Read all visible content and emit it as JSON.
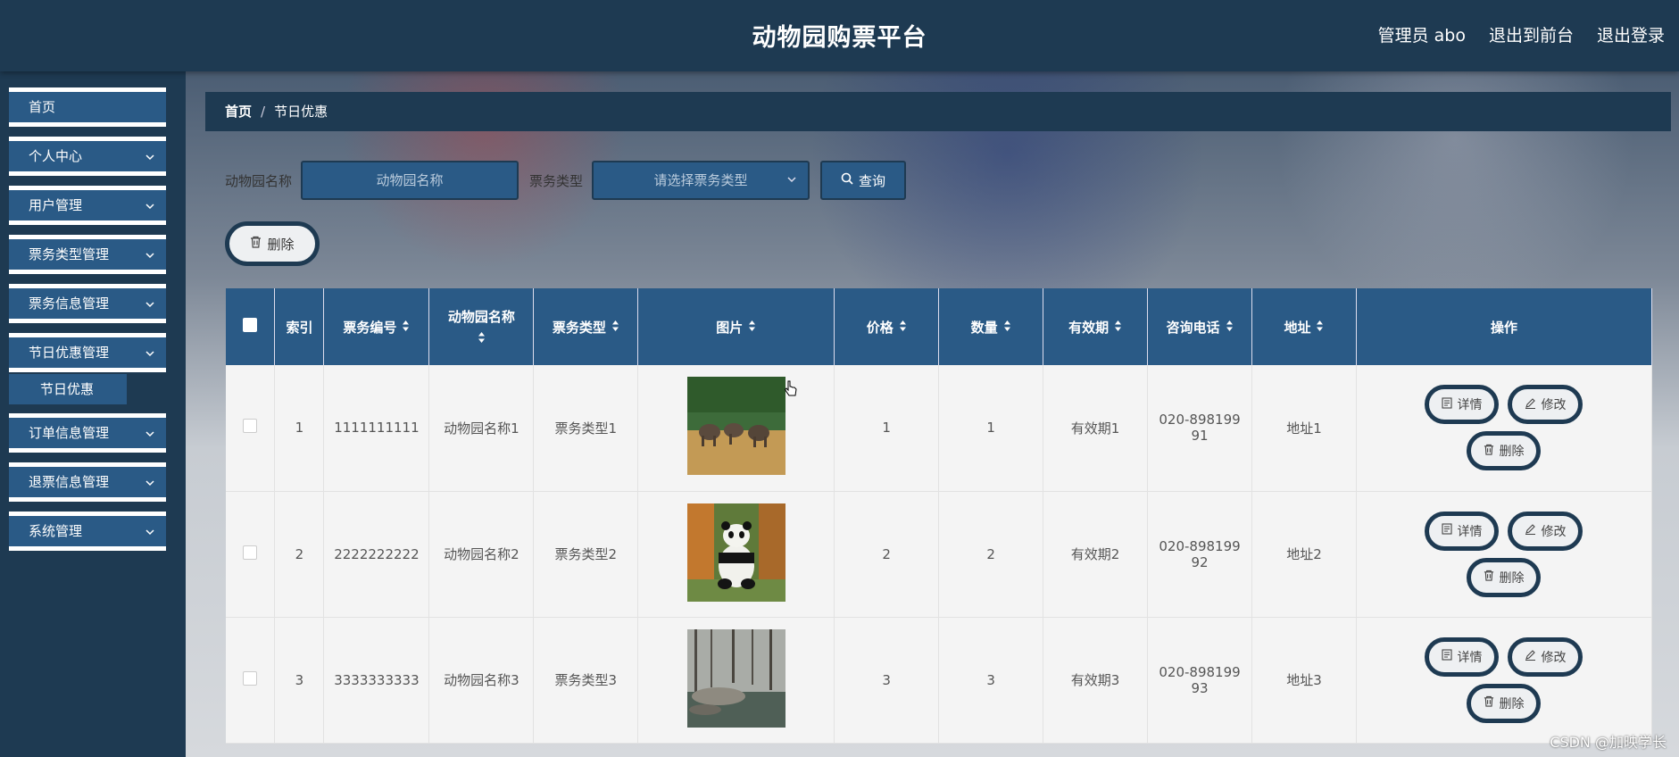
{
  "header": {
    "title": "动物园购票平台",
    "admin": "管理员 abo",
    "back_front": "退出到前台",
    "logout": "退出登录"
  },
  "sidebar": {
    "items": [
      {
        "label": "首页",
        "expandable": false
      },
      {
        "label": "个人中心",
        "expandable": true
      },
      {
        "label": "用户管理",
        "expandable": true
      },
      {
        "label": "票务类型管理",
        "expandable": true
      },
      {
        "label": "票务信息管理",
        "expandable": true
      },
      {
        "label": "节日优惠管理",
        "expandable": true
      },
      {
        "label": "订单信息管理",
        "expandable": true
      },
      {
        "label": "退票信息管理",
        "expandable": true
      },
      {
        "label": "系统管理",
        "expandable": true
      }
    ],
    "submenu_active": "节日优惠"
  },
  "breadcrumb": {
    "home": "首页",
    "sep": "/",
    "current": "节日优惠"
  },
  "search": {
    "zoo_label": "动物园名称",
    "zoo_placeholder": "动物园名称",
    "type_label": "票务类型",
    "type_placeholder": "请选择票务类型",
    "query_label": "查询"
  },
  "bulk_delete_label": "删除",
  "table": {
    "headers": [
      "索引",
      "票务编号",
      "动物园名称",
      "票务类型",
      "图片",
      "价格",
      "数量",
      "有效期",
      "咨询电话",
      "地址",
      "操作"
    ],
    "rows": [
      {
        "index": "1",
        "code": "1111111111",
        "zoo": "动物园名称1",
        "type": "票务类型1",
        "image": "elephants",
        "price": "1",
        "qty": "1",
        "valid": "有效期1",
        "phone_a": "020-898199",
        "phone_b": "91",
        "addr": "地址1"
      },
      {
        "index": "2",
        "code": "2222222222",
        "zoo": "动物园名称2",
        "type": "票务类型2",
        "image": "panda",
        "price": "2",
        "qty": "2",
        "valid": "有效期2",
        "phone_a": "020-898199",
        "phone_b": "92",
        "addr": "地址2"
      },
      {
        "index": "3",
        "code": "3333333333",
        "zoo": "动物园名称3",
        "type": "票务类型3",
        "image": "river",
        "price": "3",
        "qty": "3",
        "valid": "有效期3",
        "phone_a": "020-898199",
        "phone_b": "93",
        "addr": "地址3"
      }
    ],
    "actions": {
      "detail": "详情",
      "edit": "修改",
      "delete": "删除"
    }
  },
  "watermark": "CSDN @加映学长",
  "colors": {
    "primary": "#2a5a86",
    "dark": "#1e3a52"
  }
}
